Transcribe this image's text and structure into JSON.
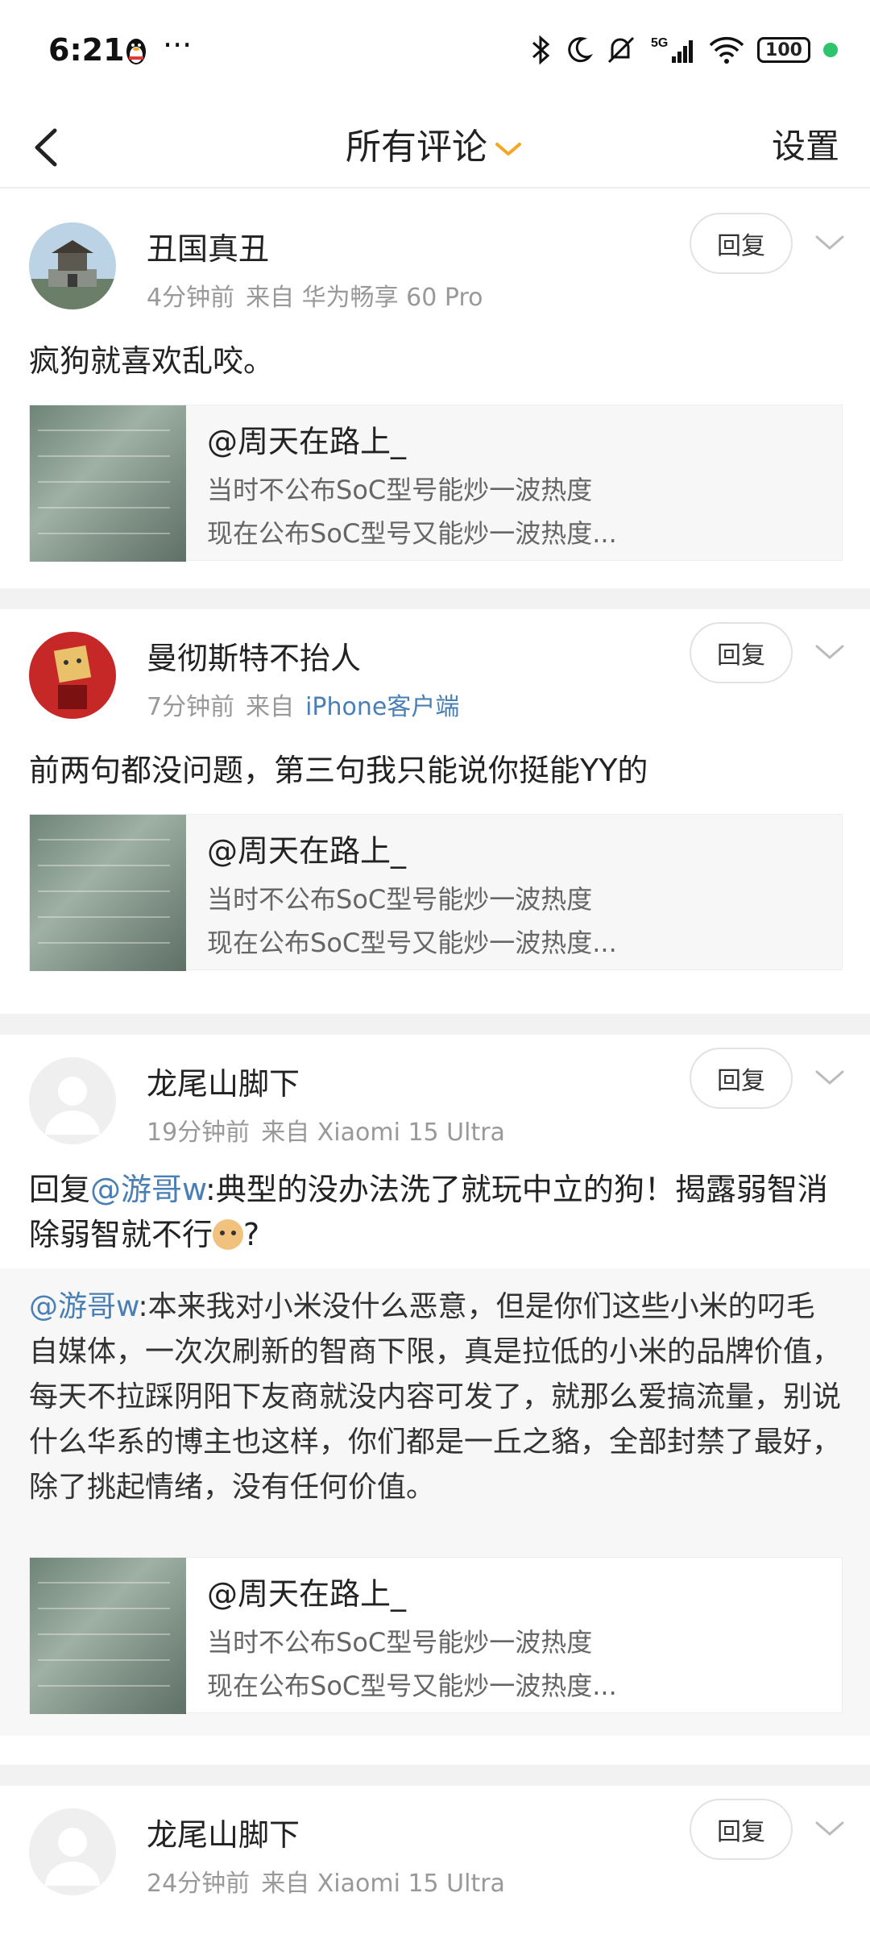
{
  "status_bar": {
    "time": "6:21",
    "more": "···",
    "battery": "100"
  },
  "nav": {
    "title": "所有评论",
    "settings": "设置"
  },
  "comments": [
    {
      "user": "丑国真丑",
      "time": "4分钟前",
      "source": "来自 华为畅享 60 Pro",
      "reply_label": "回复",
      "text": "疯狗就喜欢乱咬。",
      "card": {
        "author": "@周天在路上_",
        "line1": "当时不公布SoC型号能炒一波热度",
        "line2": "现在公布SoC型号又能炒一波热度..."
      }
    },
    {
      "user": "曼彻斯特不抬人",
      "time": "7分钟前",
      "source_prefix": "来自",
      "source_link": "iPhone客户端",
      "reply_label": "回复",
      "text": "前两句都没问题，第三句我只能说你挺能YY的",
      "card": {
        "author": "@周天在路上_",
        "line1": "当时不公布SoC型号能炒一波热度",
        "line2": "现在公布SoC型号又能炒一波热度..."
      }
    },
    {
      "user": "龙尾山脚下",
      "time": "19分钟前",
      "source": "来自 Xiaomi 15 Ultra",
      "reply_label": "回复",
      "text_prefix": "回复",
      "text_mention": "@游哥w",
      "text_body": ":典型的没办法洗了就玩中立的狗！揭露弱智消除弱智就不行",
      "text_suffix": "?",
      "quote_mention": "@游哥w",
      "quote_body": ":本来我对小米没什么恶意，但是你们这些小米的叼毛自媒体，一次次刷新的智商下限，真是拉低的小米的品牌价值，每天不拉踩阴阳下友商就没内容可发了，就那么爱搞流量，别说什么华系的博主也这样，你们都是一丘之貉，全部封禁了最好，除了挑起情绪，没有任何价值。",
      "card": {
        "author": "@周天在路上_",
        "line1": "当时不公布SoC型号能炒一波热度",
        "line2": "现在公布SoC型号又能炒一波热度..."
      }
    },
    {
      "user": "龙尾山脚下",
      "time": "24分钟前",
      "source": "来自 Xiaomi 15 Ultra",
      "reply_label": "回复"
    }
  ]
}
